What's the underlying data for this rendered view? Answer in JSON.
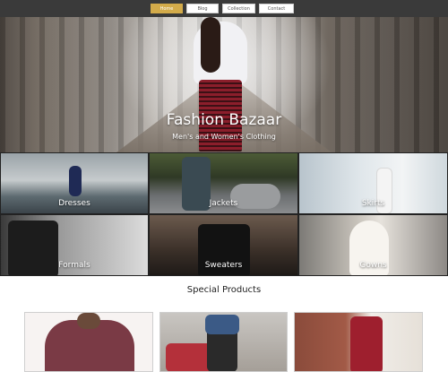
{
  "nav": {
    "items": [
      {
        "label": "Home",
        "active": true
      },
      {
        "label": "Blog",
        "active": false
      },
      {
        "label": "Collection",
        "active": false
      },
      {
        "label": "Contact",
        "active": false
      }
    ]
  },
  "hero": {
    "title": "Fashion Bazaar",
    "subtitle": "Men's and Women's Clothing"
  },
  "categories": [
    {
      "label": "Dresses"
    },
    {
      "label": "Jackets"
    },
    {
      "label": "Skirts"
    },
    {
      "label": "Formals"
    },
    {
      "label": "Sweaters"
    },
    {
      "label": "Gowns"
    }
  ],
  "special": {
    "title": "Special Products"
  },
  "colors": {
    "nav_active": "#d3ab4a",
    "topbar": "#3a3a3a"
  }
}
